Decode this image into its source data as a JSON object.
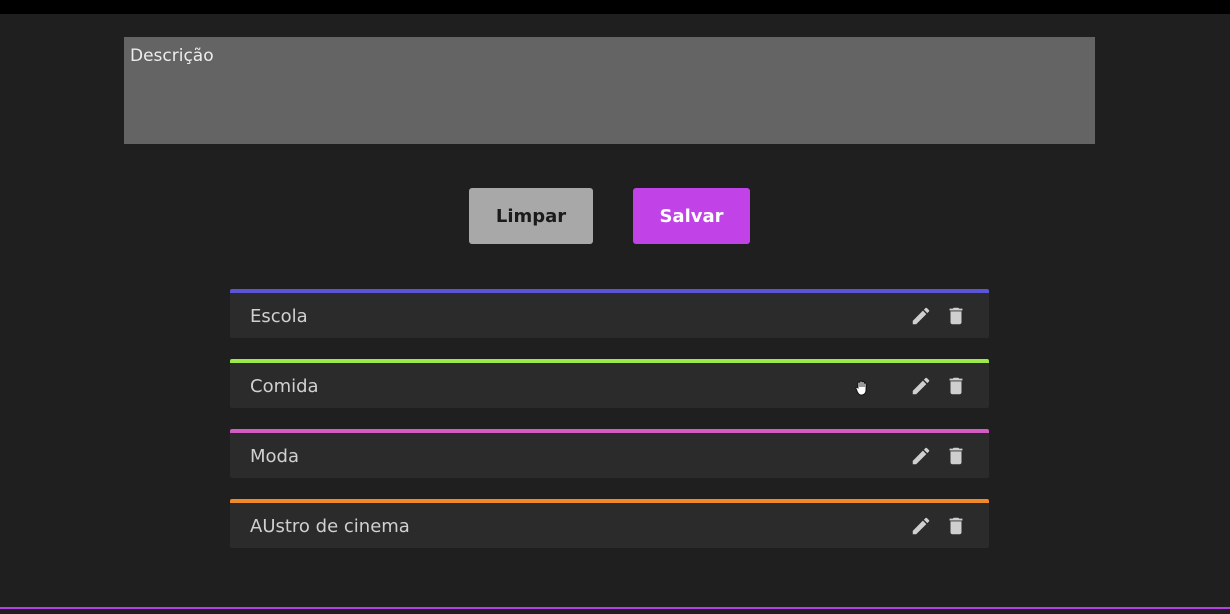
{
  "form": {
    "description_placeholder": "Descrição",
    "description_value": ""
  },
  "buttons": {
    "clear_label": "Limpar",
    "save_label": "Salvar"
  },
  "categories": [
    {
      "name": "Escola",
      "color": "#5b54d6"
    },
    {
      "name": "Comida",
      "color": "#9de84a"
    },
    {
      "name": "Moda",
      "color": "#d45ac4"
    },
    {
      "name": "AUstro de cinema",
      "color": "#f0892a"
    }
  ],
  "icons": {
    "edit": "pencil-icon",
    "delete": "trash-icon",
    "cursor": "hand-cursor-icon"
  },
  "colors": {
    "background": "#1f1f1f",
    "accent": "#c143e8",
    "clear_button": "#a8a8a8",
    "field": "#646464",
    "item_background": "#2b2b2b"
  }
}
